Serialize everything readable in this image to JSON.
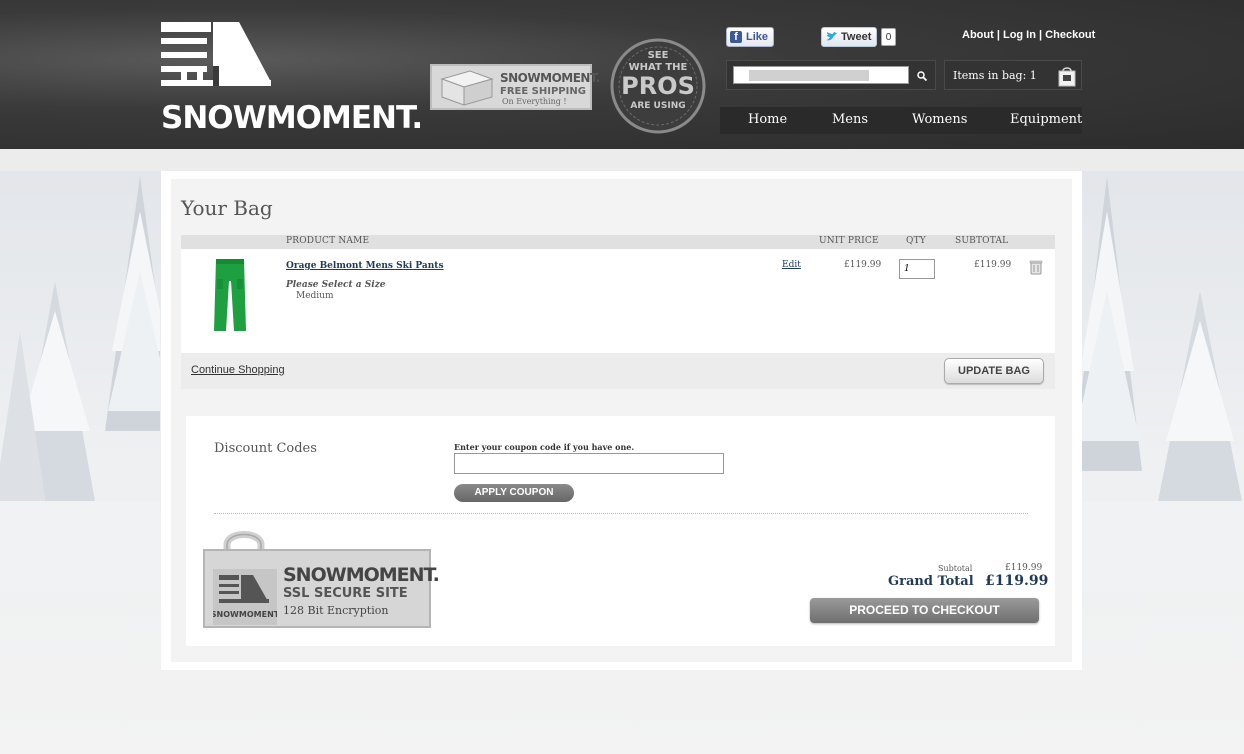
{
  "header": {
    "brand": "SNOWMOMENT.",
    "shipping": {
      "brand": "SNOWMOMENT.",
      "line1": "FREE SHIPPING",
      "line2": "On Everything !"
    },
    "pros_badge": {
      "line1": "SEE",
      "line2": "WHAT THE",
      "line3": "PROS",
      "line4": "ARE USING"
    },
    "social": {
      "like_label": "Like",
      "tweet_label": "Tweet",
      "tweet_count": "0"
    },
    "top_links": {
      "about": "About",
      "login": "Log In",
      "checkout": "Checkout",
      "sep": "|"
    },
    "search": {
      "placeholder": ""
    },
    "bag": {
      "label": "Items in bag: 1"
    },
    "nav": [
      "Home",
      "Mens",
      "Womens",
      "Equipment"
    ]
  },
  "cart": {
    "title": "Your Bag",
    "columns": {
      "product": "PRODUCT NAME",
      "unit_price": "UNIT PRICE",
      "qty": "QTY",
      "subtotal": "SUBTOTAL"
    },
    "items": [
      {
        "name": "Orage Belmont Mens Ski Pants",
        "option_label": "Please Select a Size",
        "option_value": "Medium",
        "edit": "Edit",
        "unit_price": "£119.99",
        "qty": "1",
        "subtotal": "£119.99"
      }
    ],
    "continue_label": "Continue Shopping",
    "update_label": "UPDATE BAG"
  },
  "discount": {
    "title": "Discount Codes",
    "prompt": "Enter your coupon code if you have one.",
    "apply_label": "APPLY COUPON"
  },
  "ssl": {
    "brand": "SNOWMOMENT.",
    "line1": "SSL SECURE SITE",
    "line2": "128 Bit Encryption",
    "mini_brand": "SNOWMOMENT"
  },
  "totals": {
    "subtotal_label": "Subtotal",
    "subtotal_value": "£119.99",
    "grand_label": "Grand Total",
    "grand_value": "£119.99",
    "checkout_label": "PROCEED TO CHECKOUT"
  },
  "colors": {
    "header_bg": "#2c2c2c",
    "link": "#1f3a5a",
    "product_green": "#1fa040"
  }
}
